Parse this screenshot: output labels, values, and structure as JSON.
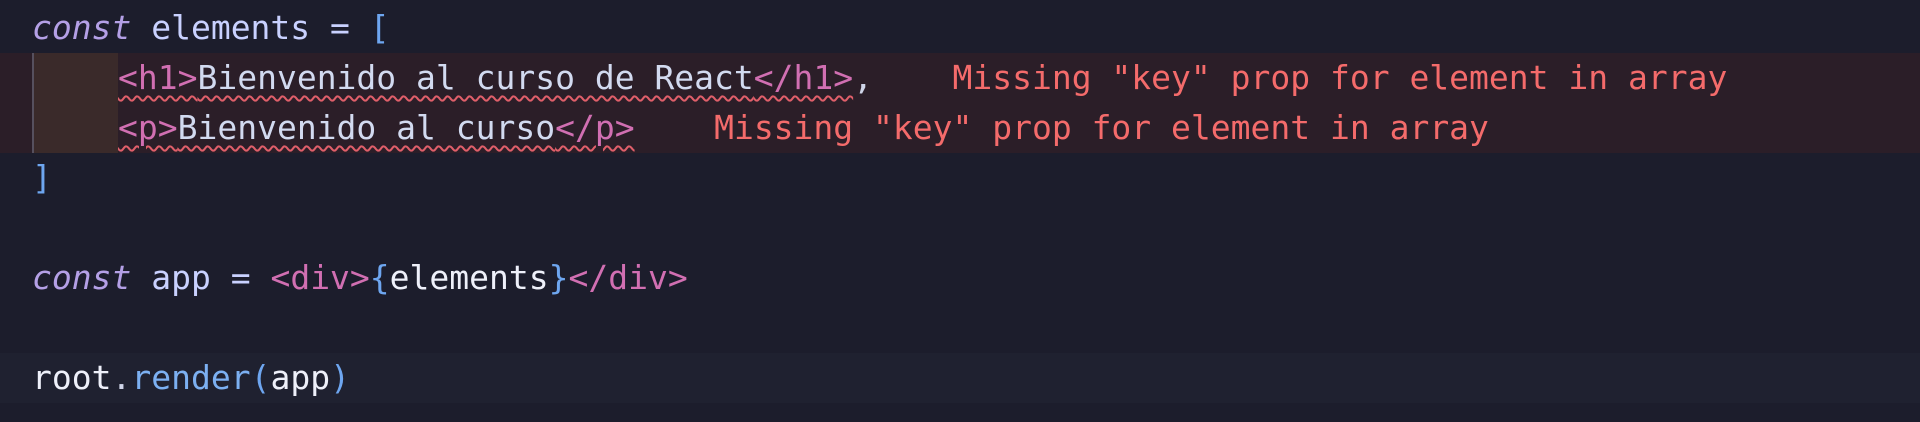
{
  "editor": {
    "lines": [
      {
        "kw": "const",
        "name": "elements",
        "op": "=",
        "open": "["
      },
      {
        "tag_open": "<h1>",
        "text": "Bienvenido al curso de React",
        "tag_close": "</h1>",
        "trail": ",",
        "diagnostic": "Missing \"key\" prop for element in array"
      },
      {
        "tag_open": "<p>",
        "text": "Bienvenido al curso",
        "tag_close": "</p>",
        "diagnostic": "Missing \"key\" prop for element in array"
      },
      {
        "close": "]"
      },
      {
        "kw": "const",
        "name": "app",
        "op": "=",
        "jsx_open": "<div>",
        "brace_open": "{",
        "expr": "elements",
        "brace_close": "}",
        "jsx_close": "</div>"
      },
      {
        "object": "root",
        "dot": ".",
        "method": "render",
        "paren_open": "(",
        "arg": "app",
        "paren_close": ")"
      }
    ]
  },
  "colors": {
    "background": "#1c1d2c",
    "error_line": "#2b1e28",
    "diagnostic": "#f46b6b",
    "keyword": "#b4a0e6",
    "tag": "#e48ac8",
    "function": "#7cb0f2"
  }
}
